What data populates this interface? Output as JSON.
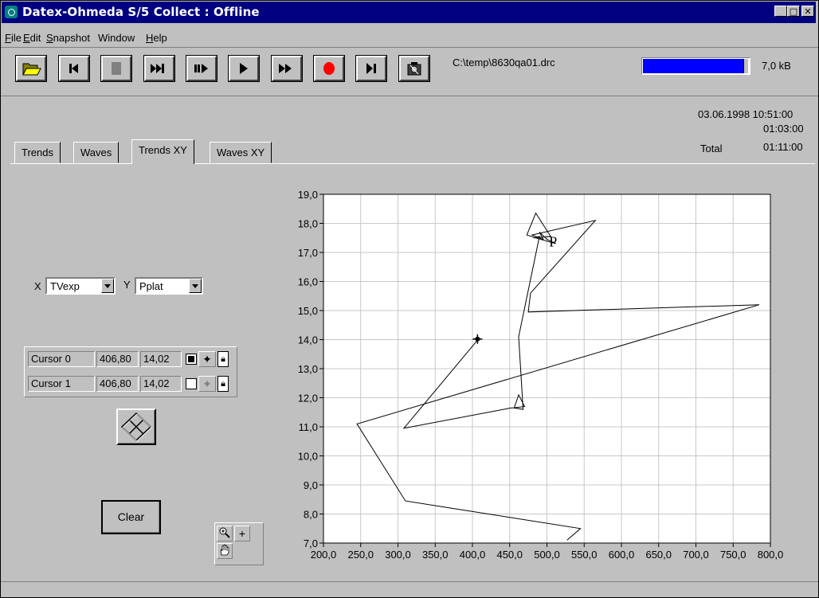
{
  "window": {
    "title": "Datex-Ohmeda S/5 Collect : Offline"
  },
  "menu": [
    {
      "label": "File",
      "key": "F",
      "rest": "ile"
    },
    {
      "label": "Edit",
      "key": "E",
      "rest": "dit"
    },
    {
      "label": "Snapshot",
      "key": "S",
      "rest": "napshot"
    },
    {
      "label": "Window",
      "key": "",
      "rest": "Window"
    },
    {
      "label": "Help",
      "key": "H",
      "rest": "elp"
    }
  ],
  "toolbar": {
    "buttons": [
      "open-folder-icon",
      "skip-to-start-icon",
      "stop-icon",
      "fast-forward-end-icon",
      "step-play-icon",
      "play-icon",
      "fast-forward-icon",
      "record-icon",
      "play-to-end-icon",
      "snapshot-icon"
    ],
    "file_path": "C:\\temp\\8630qa01.drc",
    "progress_fraction": 0.93,
    "progress_color": "#0000ff",
    "size_label": "7,0 kB"
  },
  "timestamps": {
    "datetime": "03.06.1998 10:51:00",
    "current": "01:03:00",
    "total_label": "Total",
    "total": "01:11:00"
  },
  "tabs": [
    "Trends",
    "Waves",
    "Trends XY",
    "Waves XY"
  ],
  "active_tab": "Trends XY",
  "axis_select": {
    "x_label": "X",
    "x_value": "TVexp",
    "y_label": "Y",
    "y_value": "Pplat"
  },
  "cursors": [
    {
      "name": "Cursor 0",
      "x": "406,80",
      "y": "14,02"
    },
    {
      "name": "Cursor 1",
      "x": "406,80",
      "y": "14,02"
    }
  ],
  "clear_label": "Clear",
  "chart_data": {
    "type": "line",
    "xlim": [
      200,
      800
    ],
    "ylim": [
      7,
      19
    ],
    "x_ticks": [
      "200,0",
      "250,0",
      "300,0",
      "350,0",
      "400,0",
      "450,0",
      "500,0",
      "550,0",
      "600,0",
      "650,0",
      "700,0",
      "750,0",
      "800,0"
    ],
    "y_ticks": [
      "7,0",
      "8,0",
      "9,0",
      "10,0",
      "11,0",
      "12,0",
      "13,0",
      "14,0",
      "15,0",
      "16,0",
      "17,0",
      "18,0",
      "19,0"
    ],
    "grid": true,
    "series": [
      {
        "x": [
          527,
          545,
          310,
          245,
          785,
          475,
          478,
          565,
          480,
          495,
          490,
          500,
          512,
          485,
          473,
          485,
          505,
          482,
          490,
          462,
          468,
          456,
          462,
          470,
          455,
          452,
          308,
          408
        ],
        "y": [
          7.1,
          7.5,
          8.45,
          11.1,
          15.2,
          14.95,
          15.6,
          18.1,
          17.6,
          17.45,
          17.7,
          17.45,
          17.3,
          17.5,
          17.6,
          18.35,
          17.55,
          17.5,
          17.55,
          14.1,
          11.6,
          11.65,
          12.1,
          11.7,
          11.65,
          11.65,
          10.95,
          14.02
        ]
      }
    ],
    "cursor_point": {
      "x": 406.8,
      "y": 14.02
    },
    "annotation": "P",
    "annotation_pos": {
      "x": 503,
      "y": 17.2
    }
  }
}
